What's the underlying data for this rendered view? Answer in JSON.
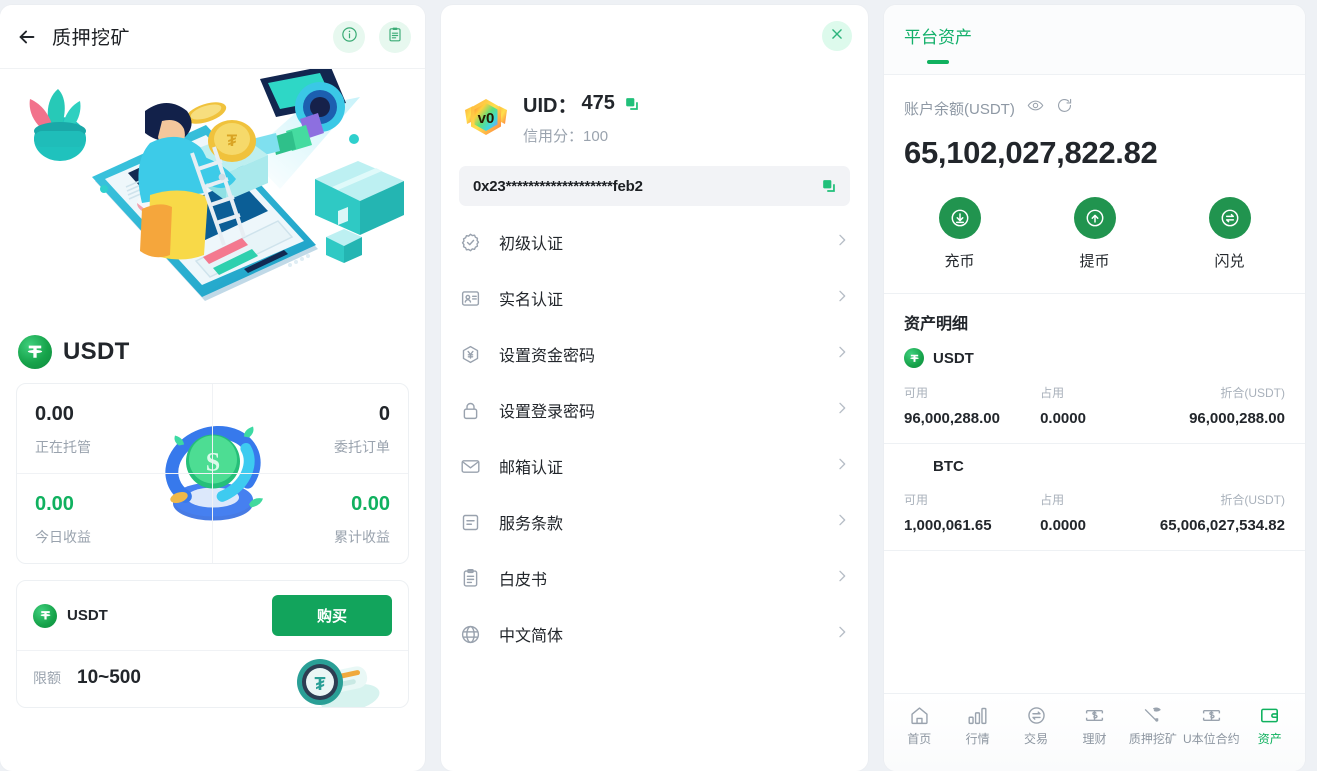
{
  "left_panel": {
    "header": {
      "back_icon": "arrow-left-icon",
      "title": "质押挖矿",
      "info_icon": "info-circle-icon",
      "record_icon": "clipboard-record-icon"
    },
    "illustration": "isometric-mining-illustration",
    "coin": {
      "symbol": "USDT",
      "logo": "usdt-logo"
    },
    "stats": [
      {
        "value": "0.00",
        "label": "正在托管",
        "color": "#22262b"
      },
      {
        "value": "0",
        "label": "委托订单",
        "color": "#22262b"
      },
      {
        "value": "0.00",
        "label": "今日收益",
        "color": "#10b15f"
      },
      {
        "value": "0.00",
        "label": "累计收益",
        "color": "#10b15f"
      }
    ],
    "buy_card": {
      "coin_symbol": "USDT",
      "buy_label": "购买",
      "limit_label": "限额",
      "limit_value": "10~500"
    }
  },
  "mid_panel": {
    "close_icon": "close-icon",
    "badge": {
      "level": "v0"
    },
    "uid_label": "UID：",
    "uid_value": "475",
    "uid_copy_icon": "copy-icon",
    "credit_label": "信用分：",
    "credit_value": "100",
    "address": "0x23*******************feb2",
    "address_copy_icon": "copy-icon",
    "menu": [
      {
        "label": "初级认证",
        "icon": "badge-check-icon"
      },
      {
        "label": "实名认证",
        "icon": "id-card-icon"
      },
      {
        "label": "设置资金密码",
        "icon": "yen-hexagon-icon"
      },
      {
        "label": "设置登录密码",
        "icon": "lock-icon"
      },
      {
        "label": "邮箱认证",
        "icon": "envelope-icon"
      },
      {
        "label": "服务条款",
        "icon": "document-lines-icon"
      },
      {
        "label": "白皮书",
        "icon": "clipboard-icon"
      },
      {
        "label": "中文简体",
        "icon": "globe-icon"
      }
    ],
    "chevron_icon": "chevron-right-icon"
  },
  "right_panel": {
    "tab": {
      "label": "平台资产"
    },
    "balance": {
      "label": "账户余额(USDT)",
      "eye_icon": "eye-icon",
      "refresh_icon": "refresh-icon",
      "value": "65,102,027,822.82"
    },
    "actions": [
      {
        "label": "充币",
        "icon": "deposit-arrow-down-icon"
      },
      {
        "label": "提币",
        "icon": "withdraw-arrow-up-icon"
      },
      {
        "label": "闪兑",
        "icon": "swap-icon"
      }
    ],
    "detail_title": "资产明细",
    "columns": {
      "available": "可用",
      "frozen": "占用",
      "converted": "折合(USDT)"
    },
    "assets": [
      {
        "symbol": "USDT",
        "has_logo": true,
        "available": "96,000,288.00",
        "frozen": "0.0000",
        "converted": "96,000,288.00"
      },
      {
        "symbol": "BTC",
        "has_logo": false,
        "available": "1,000,061.65",
        "frozen": "0.0000",
        "converted": "65,006,027,534.82"
      }
    ],
    "bottom_nav": [
      {
        "label": "首页",
        "icon": "home-icon",
        "active": false
      },
      {
        "label": "行情",
        "icon": "bar-chart-icon",
        "active": false
      },
      {
        "label": "交易",
        "icon": "swap-circle-icon",
        "active": false
      },
      {
        "label": "理财",
        "icon": "money-icon",
        "active": false
      },
      {
        "label": "质押挖矿",
        "icon": "pickaxe-icon",
        "active": false
      },
      {
        "label": "U本位合约",
        "icon": "money-contract-icon",
        "active": false
      },
      {
        "label": "资产",
        "icon": "wallet-icon",
        "active": true
      }
    ]
  },
  "theme": {
    "accent_green": "#10b15f",
    "dark_green": "#21944f",
    "page_bg": "#eef1f5",
    "muted_text": "#9aa3ae"
  }
}
